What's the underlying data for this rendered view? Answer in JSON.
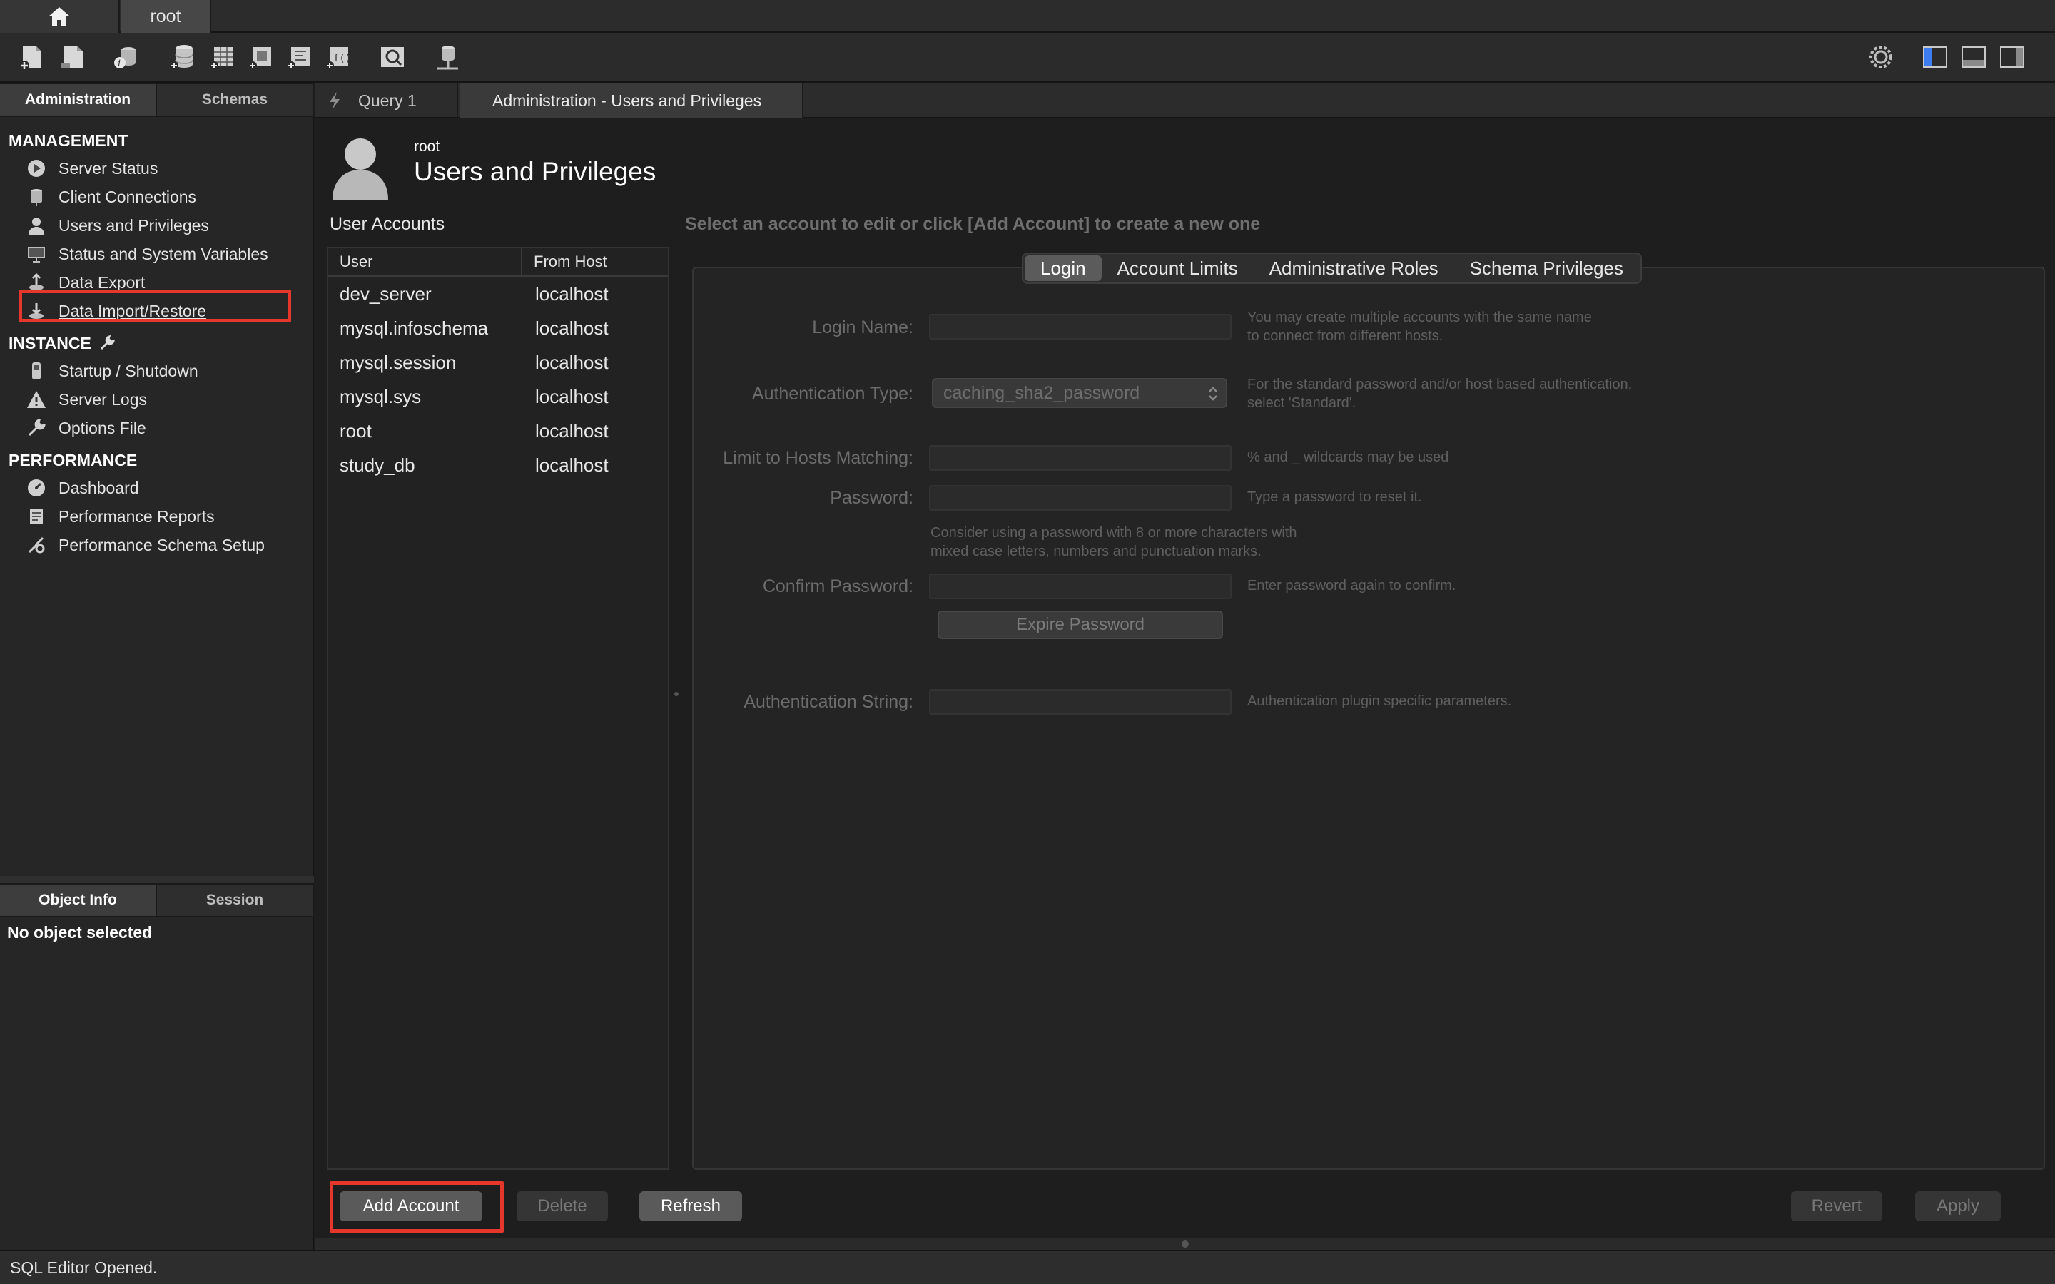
{
  "top_tabs": {
    "connection_label": "root"
  },
  "toolbar": {
    "icons": [
      "new-sql-tab-icon",
      "open-sql-script-icon",
      "inspector-icon",
      "create-schema-icon",
      "create-table-icon",
      "create-view-icon",
      "create-procedure-icon",
      "create-function-icon",
      "search-table-data-icon",
      "reconnect-icon",
      "settings-icon",
      "toggle-sidebar-icon",
      "toggle-output-icon",
      "toggle-secondary-sidebar-icon"
    ]
  },
  "sidebar": {
    "tabs": [
      "Administration",
      "Schemas"
    ],
    "sections": [
      {
        "title": "MANAGEMENT",
        "items": [
          "Server Status",
          "Client Connections",
          "Users and Privileges",
          "Status and System Variables",
          "Data Export",
          "Data Import/Restore"
        ]
      },
      {
        "title": "INSTANCE",
        "items": [
          "Startup / Shutdown",
          "Server Logs",
          "Options File"
        ]
      },
      {
        "title": "PERFORMANCE",
        "items": [
          "Dashboard",
          "Performance Reports",
          "Performance Schema Setup"
        ]
      }
    ],
    "info_tabs": [
      "Object Info",
      "Session"
    ],
    "no_object": "No object selected"
  },
  "doc_tabs": {
    "query": "Query 1",
    "admin": "Administration - Users and Privileges"
  },
  "page": {
    "subtitle": "root",
    "title": "Users and Privileges",
    "accounts_label": "User Accounts",
    "hint": "Select an account to edit or click [Add Account] to create a new one"
  },
  "accounts": {
    "columns": [
      "User",
      "From Host"
    ],
    "rows": [
      {
        "user": "dev_server",
        "host": "localhost"
      },
      {
        "user": "mysql.infoschema",
        "host": "localhost"
      },
      {
        "user": "mysql.session",
        "host": "localhost"
      },
      {
        "user": "mysql.sys",
        "host": "localhost"
      },
      {
        "user": "root",
        "host": "localhost"
      },
      {
        "user": "study_db",
        "host": "localhost"
      }
    ]
  },
  "detail_tabs": [
    "Login",
    "Account Limits",
    "Administrative Roles",
    "Schema Privileges"
  ],
  "form": {
    "login_name_label": "Login Name:",
    "login_name_help": [
      "You may create multiple accounts with the same name",
      "to connect from different hosts."
    ],
    "auth_type_label": "Authentication Type:",
    "auth_type_value": "caching_sha2_password",
    "auth_type_help": [
      "For the standard password and/or host based authentication,",
      "select 'Standard'."
    ],
    "hosts_label": "Limit to Hosts Matching:",
    "hosts_help": "% and _ wildcards may be used",
    "password_label": "Password:",
    "password_help": "Type a password to reset it.",
    "password_note": [
      "Consider using a password with 8 or more characters with",
      "mixed case letters, numbers and punctuation marks."
    ],
    "confirm_label": "Confirm Password:",
    "confirm_help": "Enter password again to confirm.",
    "expire_button": "Expire Password",
    "auth_string_label": "Authentication String:",
    "auth_string_help": "Authentication plugin specific parameters."
  },
  "buttons": {
    "add": "Add Account",
    "delete": "Delete",
    "refresh": "Refresh",
    "revert": "Revert",
    "apply": "Apply"
  },
  "status": "SQL Editor Opened.",
  "colors": {
    "highlight": "#e5372b",
    "active_tab": "#5b5b5c",
    "background": "#1e1e1f"
  }
}
